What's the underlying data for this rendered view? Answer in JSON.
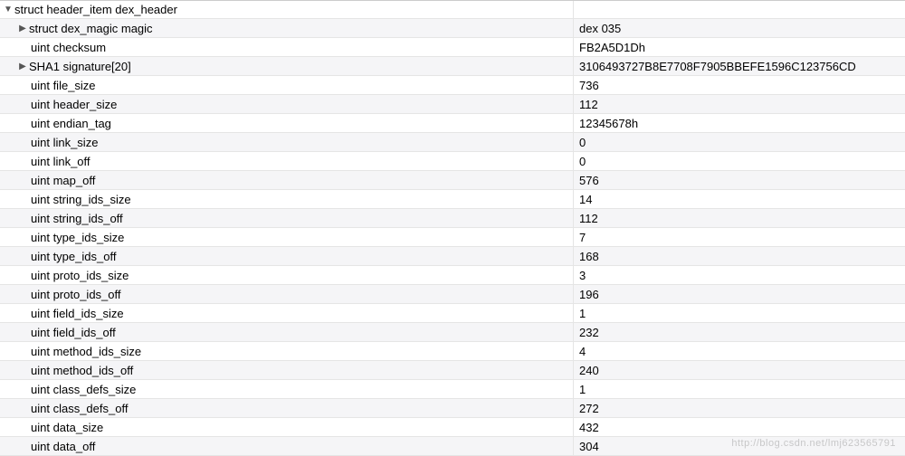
{
  "root": {
    "name": "struct header_item dex_header",
    "value": "",
    "expanded": true,
    "children": [
      {
        "name": "struct dex_magic magic",
        "value": "dex 035",
        "arrow": "right"
      },
      {
        "name": "uint checksum",
        "value": "FB2A5D1Dh"
      },
      {
        "name": "SHA1 signature[20]",
        "value": "3106493727B8E7708F7905BBEFE1596C123756CD",
        "arrow": "right"
      },
      {
        "name": "uint file_size",
        "value": "736"
      },
      {
        "name": "uint header_size",
        "value": "112"
      },
      {
        "name": "uint endian_tag",
        "value": "12345678h"
      },
      {
        "name": "uint link_size",
        "value": "0"
      },
      {
        "name": "uint link_off",
        "value": "0"
      },
      {
        "name": "uint map_off",
        "value": "576"
      },
      {
        "name": "uint string_ids_size",
        "value": "14"
      },
      {
        "name": "uint string_ids_off",
        "value": "112"
      },
      {
        "name": "uint type_ids_size",
        "value": "7"
      },
      {
        "name": "uint type_ids_off",
        "value": "168"
      },
      {
        "name": "uint proto_ids_size",
        "value": "3"
      },
      {
        "name": "uint proto_ids_off",
        "value": "196"
      },
      {
        "name": "uint field_ids_size",
        "value": "1"
      },
      {
        "name": "uint field_ids_off",
        "value": "232"
      },
      {
        "name": "uint method_ids_size",
        "value": "4"
      },
      {
        "name": "uint method_ids_off",
        "value": "240"
      },
      {
        "name": "uint class_defs_size",
        "value": "1"
      },
      {
        "name": "uint class_defs_off",
        "value": "272"
      },
      {
        "name": "uint data_size",
        "value": "432"
      },
      {
        "name": "uint data_off",
        "value": "304"
      }
    ]
  },
  "watermark": "http://blog.csdn.net/lmj623565791"
}
